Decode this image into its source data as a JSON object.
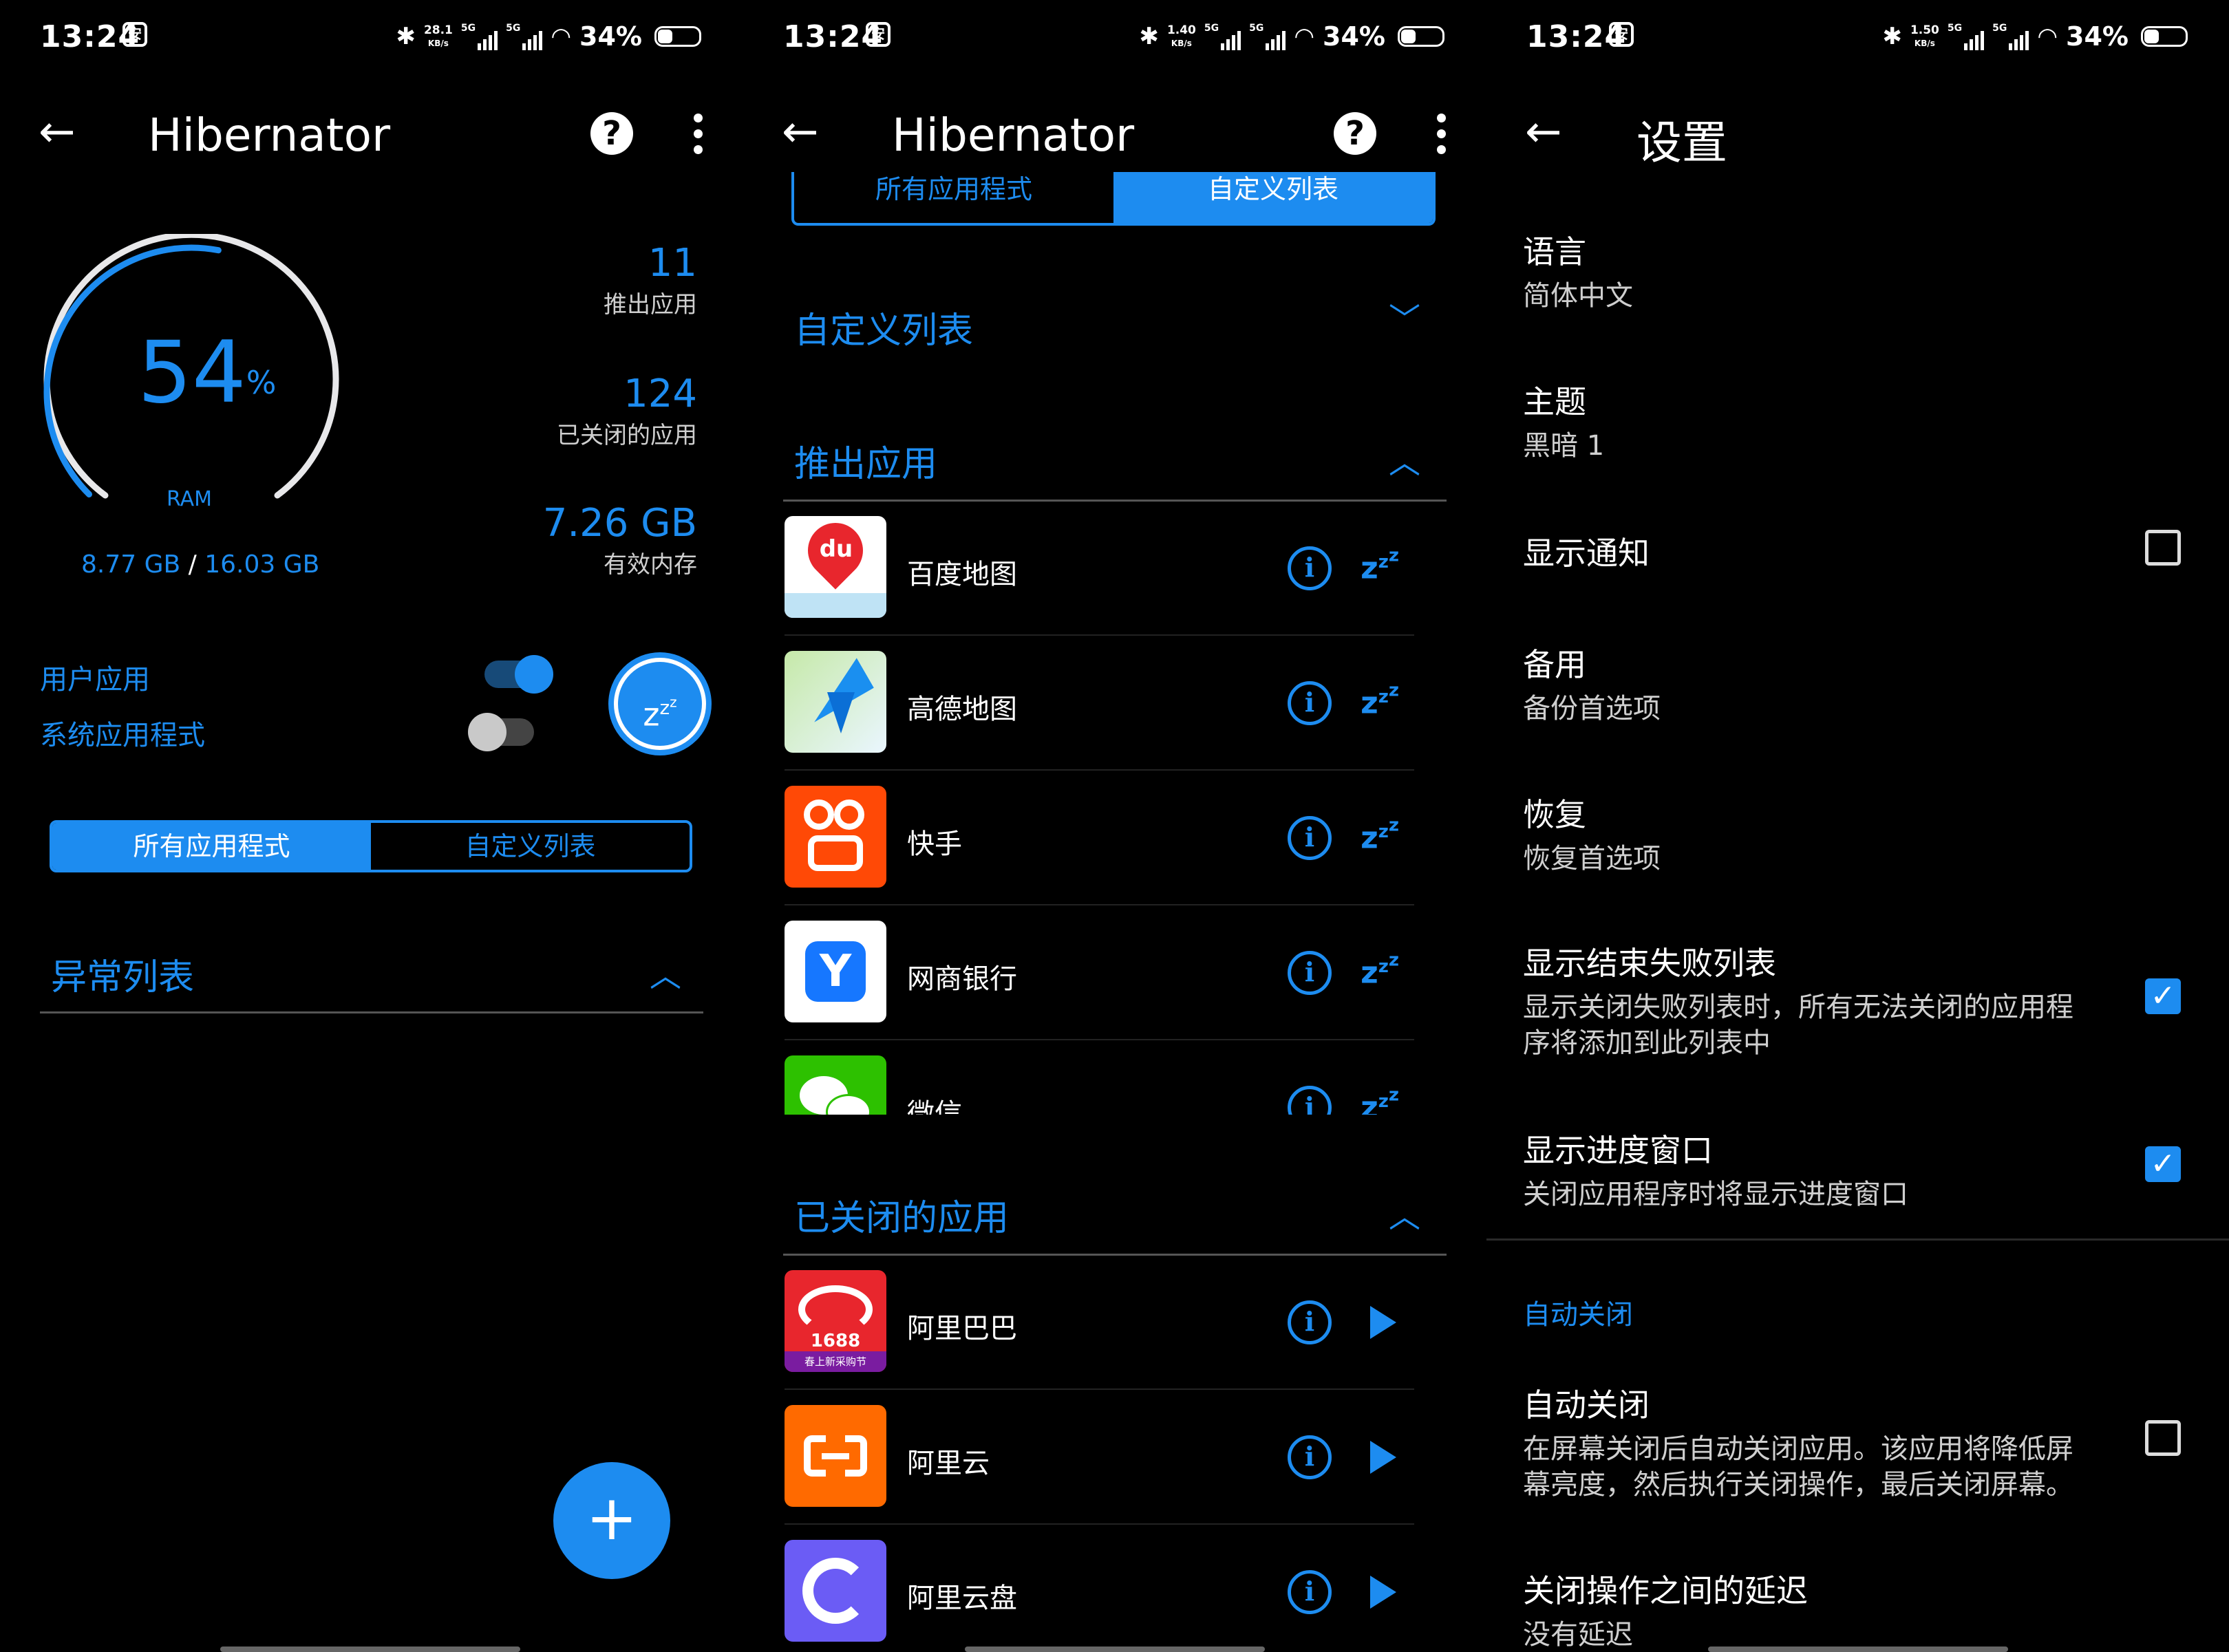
{
  "colors": {
    "accent": "#1d8cf0",
    "background": "#000000",
    "text": "#ffffff",
    "secondary": "#cfcfcf"
  },
  "status": {
    "time": "13:24",
    "battery": "34%",
    "speed1": "28.1",
    "speed2": "1.40",
    "speed3": "1.50",
    "speed_unit": "KB/s",
    "net": "5G",
    "badge": "安"
  },
  "main": {
    "title": "Hibernator",
    "help": "?",
    "gauge": {
      "value": "54",
      "unit": "%",
      "label": "RAM",
      "used": "8.77 GB",
      "sep": "/",
      "total": "16.03 GB",
      "fraction": 0.54
    },
    "stats": [
      {
        "value": "11",
        "label": "推出应用"
      },
      {
        "value": "124",
        "label": "已关闭的应用"
      },
      {
        "value": "7.26 GB",
        "label": "有效内存"
      }
    ],
    "toggles": [
      {
        "label": "用户应用",
        "on": true
      },
      {
        "label": "系统应用程式",
        "on": false
      }
    ],
    "tabs": {
      "all": "所有应用程式",
      "custom": "自定义列表"
    },
    "section": "异常列表",
    "fab": "+"
  },
  "custom": {
    "title": "Hibernator",
    "tabs": {
      "all": "所有应用程式",
      "custom": "自定义列表"
    },
    "custom_section": "自定义列表",
    "pushed_section": "推出应用",
    "pushed_apps": [
      "百度地图",
      "高德地图",
      "快手",
      "网商银行",
      "微信"
    ],
    "closed_section": "已关闭的应用",
    "closed_apps": [
      "阿里巴巴",
      "阿里云",
      "阿里云盘"
    ],
    "icon_texts": {
      "baidu": "du",
      "alibaba": "1688",
      "alibaba_sub": "春上新采购节"
    }
  },
  "settings": {
    "title": "设置",
    "items": [
      {
        "title": "语言",
        "sub": "简体中文"
      },
      {
        "title": "主题",
        "sub": "黑暗 1"
      },
      {
        "title": "显示通知",
        "sub": "",
        "checked": false
      },
      {
        "title": "备用",
        "sub": "备份首选项"
      },
      {
        "title": "恢复",
        "sub": "恢复首选项"
      },
      {
        "title": "显示结束失败列表",
        "sub": "显示关闭失败列表时，所有无法关闭的应用程序将添加到此列表中",
        "checked": true
      },
      {
        "title": "显示进度窗口",
        "sub": "关闭应用程序时将显示进度窗口",
        "checked": true
      }
    ],
    "auto_header": "自动关闭",
    "auto": [
      {
        "title": "自动关闭",
        "sub": "在屏幕关闭后自动关闭应用。该应用将降低屏幕亮度，然后执行关闭操作，最后关闭屏幕。",
        "checked": false
      },
      {
        "title": "关闭操作之间的延迟",
        "sub": "没有延迟"
      }
    ]
  }
}
